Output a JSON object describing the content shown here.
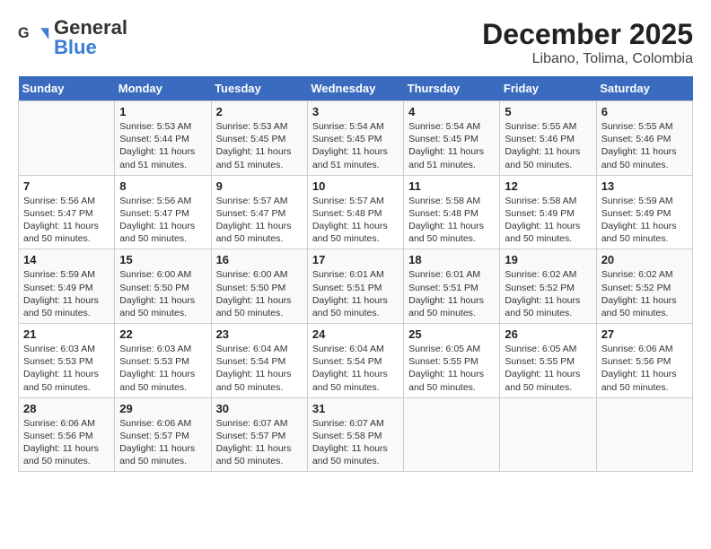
{
  "logo": {
    "line1": "General",
    "line2": "Blue"
  },
  "title": "December 2025",
  "subtitle": "Libano, Tolima, Colombia",
  "days_header": [
    "Sunday",
    "Monday",
    "Tuesday",
    "Wednesday",
    "Thursday",
    "Friday",
    "Saturday"
  ],
  "weeks": [
    [
      {
        "day": "",
        "info": ""
      },
      {
        "day": "1",
        "info": "Sunrise: 5:53 AM\nSunset: 5:44 PM\nDaylight: 11 hours\nand 51 minutes."
      },
      {
        "day": "2",
        "info": "Sunrise: 5:53 AM\nSunset: 5:45 PM\nDaylight: 11 hours\nand 51 minutes."
      },
      {
        "day": "3",
        "info": "Sunrise: 5:54 AM\nSunset: 5:45 PM\nDaylight: 11 hours\nand 51 minutes."
      },
      {
        "day": "4",
        "info": "Sunrise: 5:54 AM\nSunset: 5:45 PM\nDaylight: 11 hours\nand 51 minutes."
      },
      {
        "day": "5",
        "info": "Sunrise: 5:55 AM\nSunset: 5:46 PM\nDaylight: 11 hours\nand 50 minutes."
      },
      {
        "day": "6",
        "info": "Sunrise: 5:55 AM\nSunset: 5:46 PM\nDaylight: 11 hours\nand 50 minutes."
      }
    ],
    [
      {
        "day": "7",
        "info": "Sunrise: 5:56 AM\nSunset: 5:47 PM\nDaylight: 11 hours\nand 50 minutes."
      },
      {
        "day": "8",
        "info": "Sunrise: 5:56 AM\nSunset: 5:47 PM\nDaylight: 11 hours\nand 50 minutes."
      },
      {
        "day": "9",
        "info": "Sunrise: 5:57 AM\nSunset: 5:47 PM\nDaylight: 11 hours\nand 50 minutes."
      },
      {
        "day": "10",
        "info": "Sunrise: 5:57 AM\nSunset: 5:48 PM\nDaylight: 11 hours\nand 50 minutes."
      },
      {
        "day": "11",
        "info": "Sunrise: 5:58 AM\nSunset: 5:48 PM\nDaylight: 11 hours\nand 50 minutes."
      },
      {
        "day": "12",
        "info": "Sunrise: 5:58 AM\nSunset: 5:49 PM\nDaylight: 11 hours\nand 50 minutes."
      },
      {
        "day": "13",
        "info": "Sunrise: 5:59 AM\nSunset: 5:49 PM\nDaylight: 11 hours\nand 50 minutes."
      }
    ],
    [
      {
        "day": "14",
        "info": "Sunrise: 5:59 AM\nSunset: 5:49 PM\nDaylight: 11 hours\nand 50 minutes."
      },
      {
        "day": "15",
        "info": "Sunrise: 6:00 AM\nSunset: 5:50 PM\nDaylight: 11 hours\nand 50 minutes."
      },
      {
        "day": "16",
        "info": "Sunrise: 6:00 AM\nSunset: 5:50 PM\nDaylight: 11 hours\nand 50 minutes."
      },
      {
        "day": "17",
        "info": "Sunrise: 6:01 AM\nSunset: 5:51 PM\nDaylight: 11 hours\nand 50 minutes."
      },
      {
        "day": "18",
        "info": "Sunrise: 6:01 AM\nSunset: 5:51 PM\nDaylight: 11 hours\nand 50 minutes."
      },
      {
        "day": "19",
        "info": "Sunrise: 6:02 AM\nSunset: 5:52 PM\nDaylight: 11 hours\nand 50 minutes."
      },
      {
        "day": "20",
        "info": "Sunrise: 6:02 AM\nSunset: 5:52 PM\nDaylight: 11 hours\nand 50 minutes."
      }
    ],
    [
      {
        "day": "21",
        "info": "Sunrise: 6:03 AM\nSunset: 5:53 PM\nDaylight: 11 hours\nand 50 minutes."
      },
      {
        "day": "22",
        "info": "Sunrise: 6:03 AM\nSunset: 5:53 PM\nDaylight: 11 hours\nand 50 minutes."
      },
      {
        "day": "23",
        "info": "Sunrise: 6:04 AM\nSunset: 5:54 PM\nDaylight: 11 hours\nand 50 minutes."
      },
      {
        "day": "24",
        "info": "Sunrise: 6:04 AM\nSunset: 5:54 PM\nDaylight: 11 hours\nand 50 minutes."
      },
      {
        "day": "25",
        "info": "Sunrise: 6:05 AM\nSunset: 5:55 PM\nDaylight: 11 hours\nand 50 minutes."
      },
      {
        "day": "26",
        "info": "Sunrise: 6:05 AM\nSunset: 5:55 PM\nDaylight: 11 hours\nand 50 minutes."
      },
      {
        "day": "27",
        "info": "Sunrise: 6:06 AM\nSunset: 5:56 PM\nDaylight: 11 hours\nand 50 minutes."
      }
    ],
    [
      {
        "day": "28",
        "info": "Sunrise: 6:06 AM\nSunset: 5:56 PM\nDaylight: 11 hours\nand 50 minutes."
      },
      {
        "day": "29",
        "info": "Sunrise: 6:06 AM\nSunset: 5:57 PM\nDaylight: 11 hours\nand 50 minutes."
      },
      {
        "day": "30",
        "info": "Sunrise: 6:07 AM\nSunset: 5:57 PM\nDaylight: 11 hours\nand 50 minutes."
      },
      {
        "day": "31",
        "info": "Sunrise: 6:07 AM\nSunset: 5:58 PM\nDaylight: 11 hours\nand 50 minutes."
      },
      {
        "day": "",
        "info": ""
      },
      {
        "day": "",
        "info": ""
      },
      {
        "day": "",
        "info": ""
      }
    ]
  ]
}
